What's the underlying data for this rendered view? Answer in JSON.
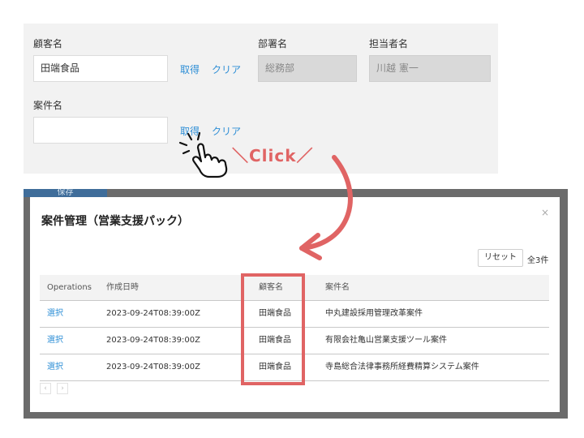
{
  "form": {
    "customer_label": "顧客名",
    "customer_value": "田端食品",
    "department_label": "部署名",
    "department_value": "総務部",
    "owner_label": "担当者名",
    "owner_value": "川越 憲一",
    "case_label": "案件名",
    "case_value": "",
    "fetch_label": "取得",
    "clear_label": "クリア"
  },
  "annotation": {
    "click_text": "＼Click／"
  },
  "background": {
    "save_label": "保存"
  },
  "modal": {
    "title": "案件管理（営業支援パック）",
    "close_glyph": "×",
    "reset_label": "リセット",
    "total_count": "全3件",
    "columns": [
      "Operations",
      "作成日時",
      "顧客名",
      "案件名"
    ],
    "rows": [
      {
        "op": "選択",
        "created": "2023-09-24T08:39:00Z",
        "customer": "田端食品",
        "case": "中丸建設採用管理改革案件"
      },
      {
        "op": "選択",
        "created": "2023-09-24T08:39:00Z",
        "customer": "田端食品",
        "case": "有限会社亀山営業支援ツール案件"
      },
      {
        "op": "選択",
        "created": "2023-09-24T08:39:00Z",
        "customer": "田端食品",
        "case": "寺島総合法律事務所経費精算システム案件"
      }
    ],
    "pager_prev": "‹",
    "pager_next": "›"
  },
  "colors": {
    "accent_link": "#2f8fd6",
    "annotation_red": "#e06464"
  }
}
